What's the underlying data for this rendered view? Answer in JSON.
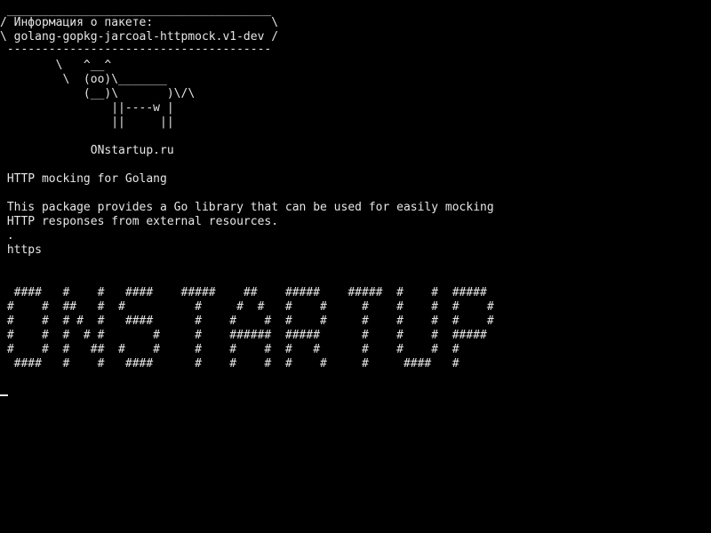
{
  "colors": {
    "background": "#000000",
    "foreground": "#e6e6e6"
  },
  "cowsay": {
    "border_top": " ______________________________________",
    "title_line": "/ Информация о пакете:                 \\",
    "package_line": "\\ golang-gopkg-jarcoal-httpmock.v1-dev /",
    "border_bottom": " --------------------------------------",
    "cow_1": "        \\   ^__^",
    "cow_2": "         \\  (oo)\\_______",
    "cow_3": "            (__)\\       )\\/\\",
    "cow_4": "                ||----w |",
    "cow_5": "                ||     ||"
  },
  "site": "             ONstartup.ru",
  "description": {
    "title": " HTTP mocking for Golang",
    "text_1": " This package provides a Go library that can be used for easily mocking",
    "text_2": " HTTP responses from external resources.",
    "dot": " .",
    "homepage": " https"
  },
  "banner": [
    "  ####   #    #   ####    #####    ##    #####    #####  #    #  #####",
    " #    #  ##   #  #          #     #  #   #    #     #    #    #  #    #",
    " #    #  # #  #   ####      #    #    #  #    #     #    #    #  #    #",
    " #    #  #  # #       #     #    ######  #####      #    #    #  #####",
    " #    #  #   ##  #    #     #    #    #  #   #      #    #    #  #",
    "  ####   #    #   ####      #    #    #  #    #     #     ####   #"
  ]
}
